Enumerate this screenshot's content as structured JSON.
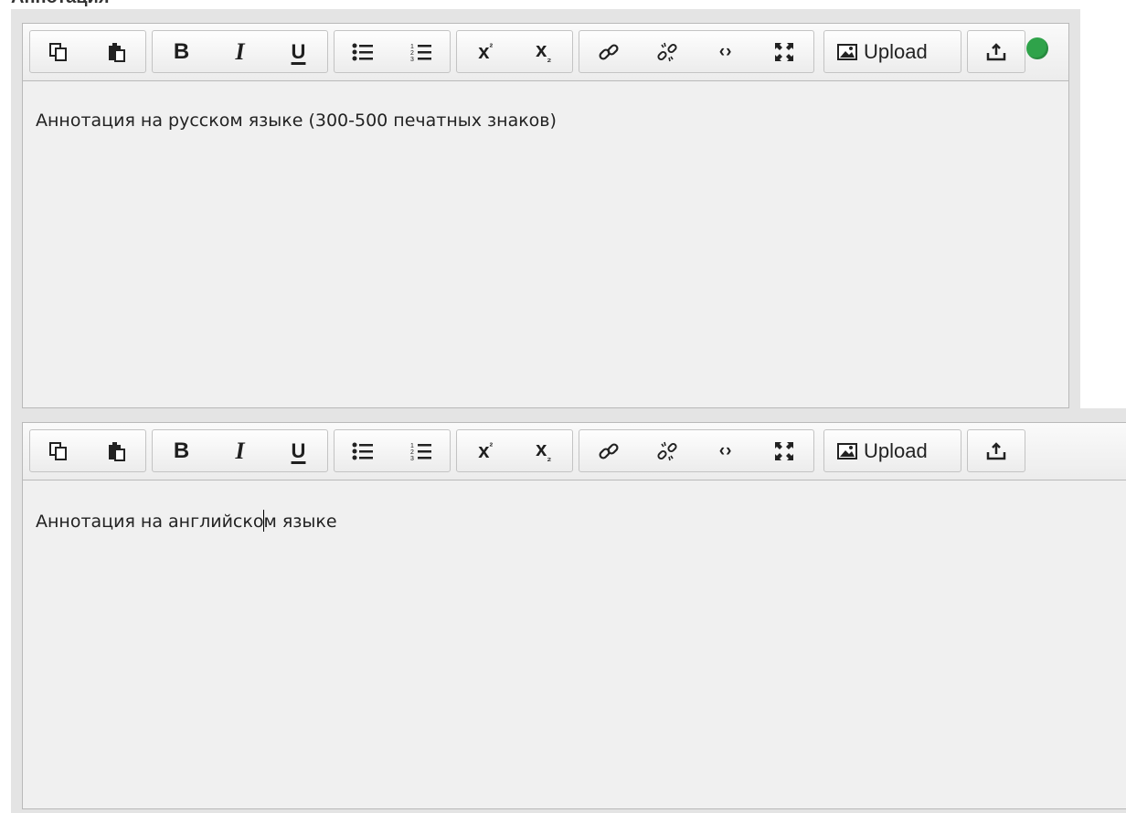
{
  "section": {
    "title": "Аннотация"
  },
  "editors": [
    {
      "toolbar": {
        "upload_label": "Upload"
      },
      "content": "Аннотация на русском языке (300-500 печатных знаков)"
    },
    {
      "toolbar": {
        "upload_label": "Upload"
      },
      "content_before_caret": "Аннотация на английско",
      "content_after_caret": "м языке"
    }
  ],
  "icons": {
    "copy": "copy-icon",
    "paste": "paste-icon",
    "bold": "bold-icon",
    "italic": "italic-icon",
    "underline": "underline-icon",
    "bullets": "bulleted-list-icon",
    "numbers": "numbered-list-icon",
    "superscript": "superscript-icon",
    "subscript": "subscript-icon",
    "link": "link-icon",
    "unlink": "unlink-icon",
    "code": "code-icon",
    "fullscreen": "fullscreen-icon",
    "image": "image-icon",
    "upload_arrow": "upload-arrow-icon",
    "globe": "globe-icon"
  },
  "colors": {
    "editor_bg": "#f0f0f0",
    "frame_bg": "#e4e4e4",
    "globe": "#2fa34a"
  }
}
